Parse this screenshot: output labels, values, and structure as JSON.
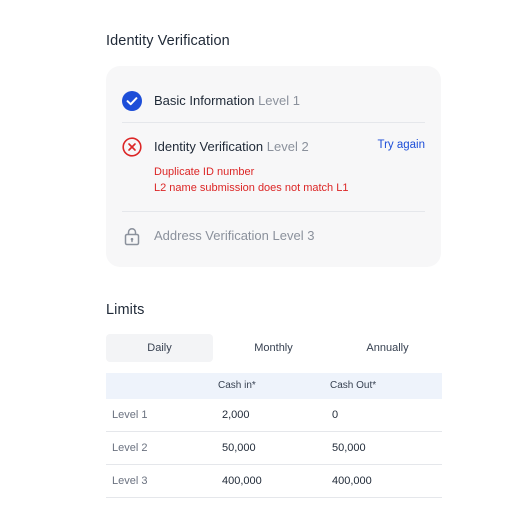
{
  "verification": {
    "title": "Identity Verification",
    "steps": [
      {
        "name": "Basic Information",
        "level": "Level 1",
        "status": "complete"
      },
      {
        "name": "Identity Verification",
        "level": "Level 2",
        "status": "failed",
        "action": "Try again",
        "errors": [
          "Duplicate ID number",
          "L2 name submission does not match L1"
        ]
      },
      {
        "name": "Address Verification",
        "level": "Level 3",
        "status": "locked"
      }
    ]
  },
  "limits": {
    "title": "Limits",
    "tabs": [
      "Daily",
      "Monthly",
      "Annually"
    ],
    "active_tab": "Daily",
    "columns": [
      "",
      "Cash in*",
      "Cash Out*"
    ],
    "rows": [
      {
        "level": "Level 1",
        "cash_in": "2,000",
        "cash_out": "0"
      },
      {
        "level": "Level 2",
        "cash_in": "50,000",
        "cash_out": "50,000"
      },
      {
        "level": "Level 3",
        "cash_in": "400,000",
        "cash_out": "400,000"
      }
    ]
  },
  "colors": {
    "complete": "#1d4ed8",
    "error": "#dc2626",
    "link": "#1d4ed8",
    "card_bg": "#f7f7f8",
    "table_header_bg": "#eef3fb"
  }
}
